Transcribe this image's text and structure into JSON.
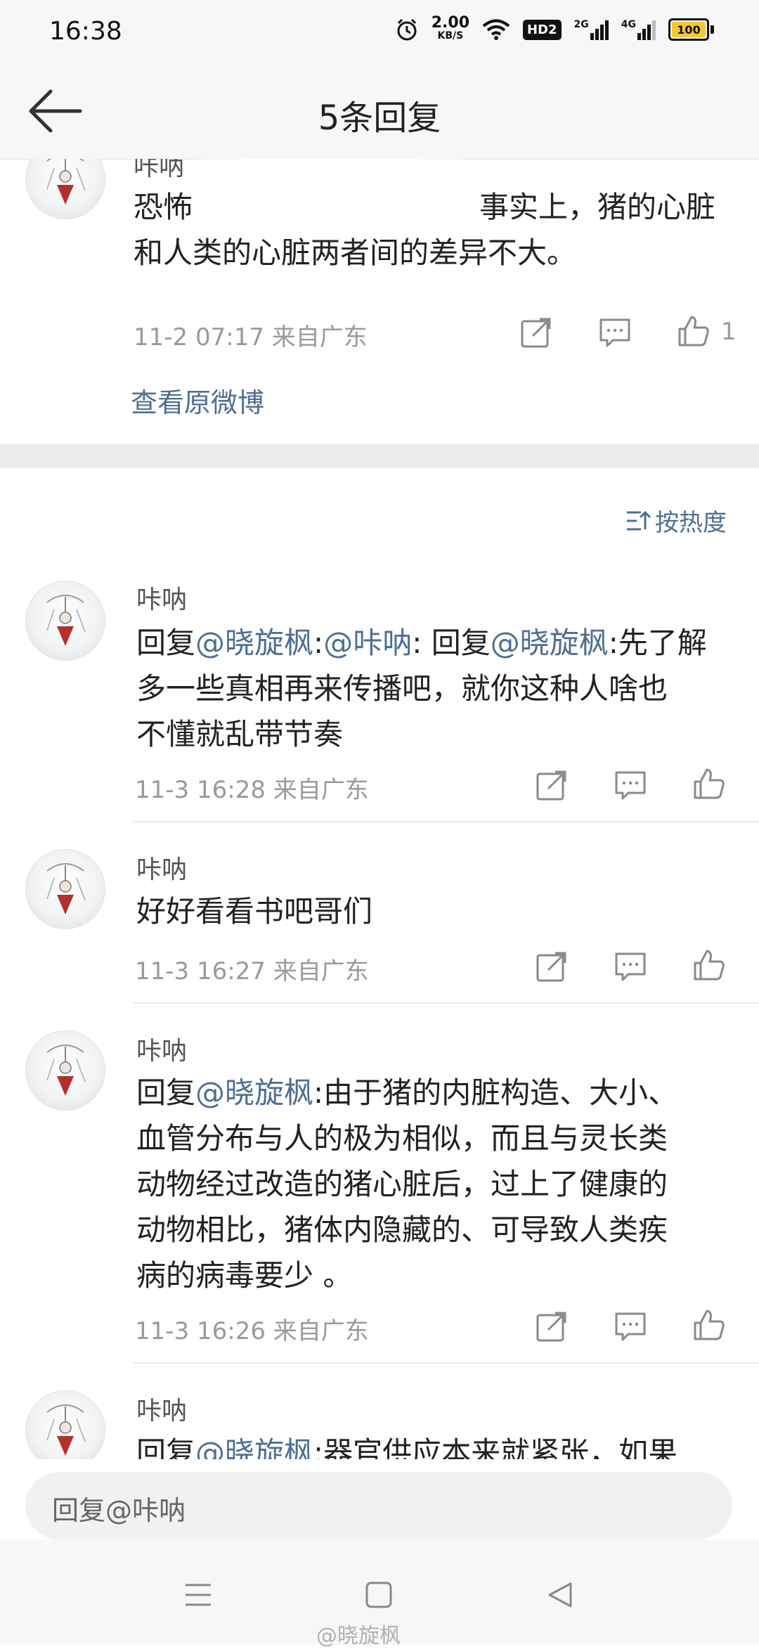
{
  "status_bar": {
    "time": "16:38",
    "net_speed_value": "2.00",
    "net_speed_unit": "KB/S",
    "hd_label": "HD2",
    "net_2g": "2G",
    "net_4g": "4G",
    "battery": "100"
  },
  "nav": {
    "title": "5条回复"
  },
  "original_comment": {
    "author": "咔呐",
    "text_part1": "恐怖",
    "text_part2": "事实上，猪的心脏",
    "text_line2": "和人类的心脏两者间的差异不大。",
    "meta": "11-2 07:17  来自广东",
    "like_count": "1",
    "view_original": "查看原微博"
  },
  "sort": {
    "label": "按热度"
  },
  "replies": [
    {
      "author": "咔呐",
      "line1_prefix": "回复",
      "line1_mention1": "@晓旋枫",
      "line1_mid": ":",
      "line1_mention2": "@咔呐",
      "line1_mid2": ": 回复",
      "line1_mention3": "@晓旋枫",
      "line1_suffix": ":先了解",
      "line2": "多一些真相再来传播吧，就你这种人啥也",
      "line3": "不懂就乱带节奏",
      "meta": "11-3 16:28  来自广东"
    },
    {
      "author": "咔呐",
      "line1": "好好看看书吧哥们",
      "meta": "11-3 16:27  来自广东"
    },
    {
      "author": "咔呐",
      "line1_prefix": "回复",
      "line1_mention": "@晓旋枫",
      "line1_suffix": ":由于猪的内脏构造、大小、",
      "line2": "血管分布与人的极为相似，而且与灵长类",
      "line3": "动物经过改造的猪心脏后，过上了健康的",
      "line4": "动物相比，猪体内隐藏的、可导致人类疾",
      "line5": "病的病毒要少 。",
      "meta": "11-3 16:26  来自广东"
    },
    {
      "author": "咔呐",
      "line1_prefix": "回复",
      "line1_mention": "@晓旋枫",
      "line1_suffix": ":器官供应本来就紧张，如果"
    }
  ],
  "reply_input": {
    "placeholder": "回复@咔呐"
  },
  "watermark": "@晓旋枫",
  "colors": {
    "link": "#4e6f94",
    "text": "#222222",
    "meta": "#9a9a9a",
    "bar_bg": "#f7f7f7"
  },
  "icons": [
    "back-arrow-icon",
    "share-icon",
    "comment-icon",
    "like-icon",
    "sort-icon",
    "menu-icon",
    "home-square-icon",
    "back-triangle-icon",
    "alarm-icon",
    "wifi-icon",
    "signal-icon"
  ]
}
